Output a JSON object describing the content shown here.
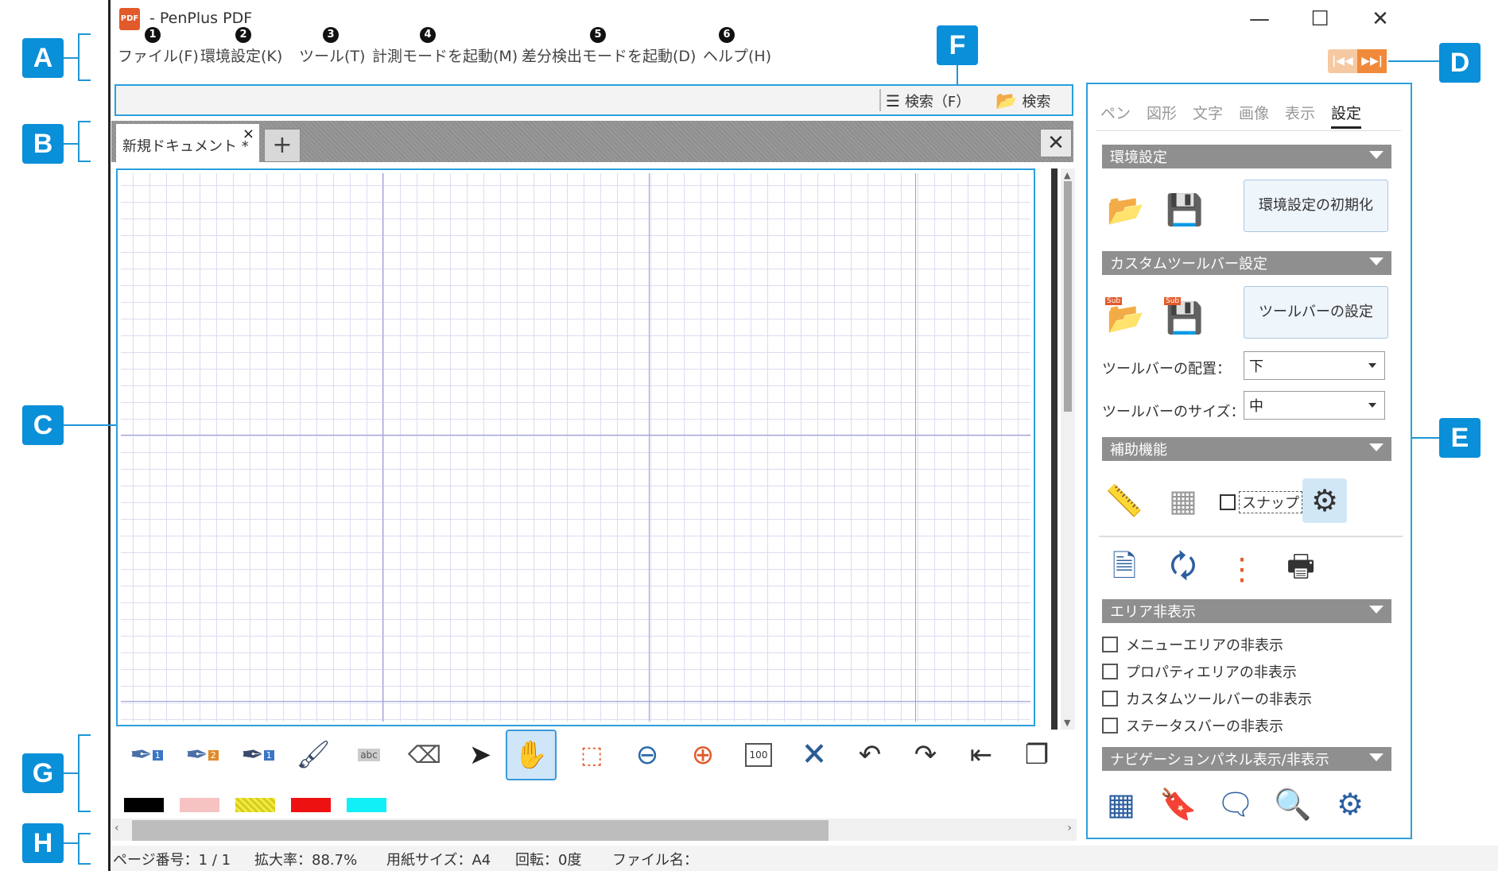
{
  "app": {
    "title": "- PenPlus PDF",
    "icon_label": "PDF"
  },
  "window_controls": {
    "minimize": "—",
    "maximize": "☐",
    "close": "✕"
  },
  "menu": [
    {
      "num": "1",
      "label": "ファイル(F)"
    },
    {
      "num": "2",
      "label": "環境設定(K)"
    },
    {
      "num": "3",
      "label": "ツール(T)"
    },
    {
      "num": "4",
      "label": "計測モードを起動(M)"
    },
    {
      "num": "5",
      "label": "差分検出モードを起動(D)"
    },
    {
      "num": "6",
      "label": "ヘルプ(H)"
    }
  ],
  "search": {
    "search_f_label": "検索（F）",
    "search_label": "検索"
  },
  "document_tabs": [
    {
      "label": "新規ドキュメント *",
      "close": "×"
    }
  ],
  "add_tab_label": "+",
  "tabbar_close": "✕",
  "callouts": {
    "A": "A",
    "B": "B",
    "C": "C",
    "D": "D",
    "E": "E",
    "F": "F",
    "G": "G",
    "H": "H"
  },
  "panel": {
    "tabs": [
      "ペン",
      "図形",
      "文字",
      "画像",
      "表示",
      "設定"
    ],
    "active_tab": "設定",
    "sections": {
      "env": "環境設定",
      "custom_toolbar": "カスタムツールバー設定",
      "assist": "補助機能",
      "area_hide": "エリア非表示",
      "nav_panel": "ナビゲーションパネル表示/非表示"
    },
    "env_reset_button": "環境設定の初期化",
    "toolbar_setting_button": "ツールバーの設定",
    "toolbar_position_label": "ツールバーの配置：",
    "toolbar_position_value": "下",
    "toolbar_size_label": "ツールバーのサイズ：",
    "toolbar_size_value": "中",
    "snap_label": "スナップ",
    "sub_badge": "Sub",
    "area_checkboxes": [
      "メニューエリアの非表示",
      "プロパティエリアの非表示",
      "カスタムツールバーの非表示",
      "ステータスバーの非表示"
    ]
  },
  "toolbar": {
    "colors": [
      "#000000",
      "#f7c2c2",
      "#f3ea4a",
      "#ee1111",
      "#11f0f6"
    ],
    "zoom_page_label": "100",
    "marker_label": "abc",
    "pen_nums": [
      "1",
      "2",
      "1"
    ]
  },
  "status": {
    "page": "ページ番号：1 / 1",
    "zoom": "拡大率：88.7%",
    "paper": "用紙サイズ：A4",
    "rotation": "回転：0度",
    "filename": "ファイル名："
  },
  "nav": {
    "prev": "|◀◀",
    "next": "▶▶|"
  }
}
